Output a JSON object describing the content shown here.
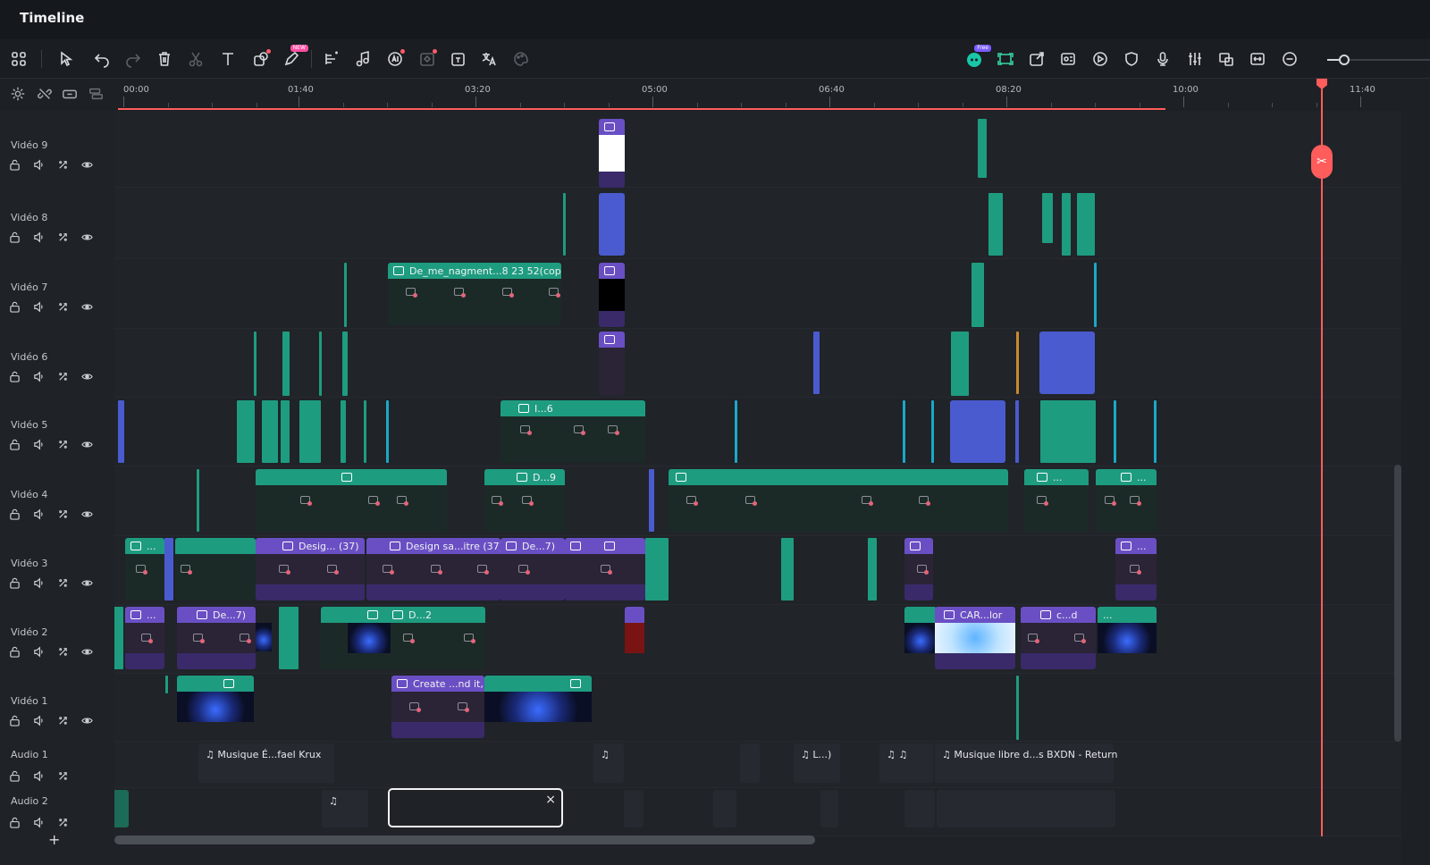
{
  "window": {
    "title": "Timeline"
  },
  "toolbar": {
    "left_tools": [
      "grid-menu",
      "select-pointer",
      "undo",
      "redo",
      "delete",
      "split",
      "text",
      "crop",
      "paint-pen",
      "speed-ramp",
      "audio-beat",
      "ai-tool",
      "keyframe",
      "extract",
      "translate",
      "color-palette"
    ],
    "new_badge": "NEW",
    "free_badge": "Free",
    "right_tools": [
      "ai-mate",
      "auto-reframe",
      "export-clip",
      "multicam",
      "motion-track",
      "shield",
      "microphone",
      "mixer",
      "split-screen",
      "fit-timeline",
      "zoom-out"
    ],
    "zoom_level": 0.15
  },
  "ruler": {
    "labels": [
      "00:00",
      "01:40",
      "03:20",
      "05:00",
      "06:40",
      "08:20",
      "10:00",
      "11:40"
    ]
  },
  "tracks": [
    {
      "name": "Vidéo 9"
    },
    {
      "name": "Vidéo 8"
    },
    {
      "name": "Vidéo 7"
    },
    {
      "name": "Vidéo 6"
    },
    {
      "name": "Vidéo 5"
    },
    {
      "name": "Vidéo 4"
    },
    {
      "name": "Vidéo 3"
    },
    {
      "name": "Vidéo 2"
    },
    {
      "name": "Vidéo 1"
    },
    {
      "name": "Audio 1"
    },
    {
      "name": "Audio 2"
    }
  ],
  "clips": {
    "v7_main": "De_me_nagment...8 23 52(copy)",
    "v5_a": "I...6",
    "v4_a": "D...9",
    "v4_b": "...",
    "v4_c": "...",
    "v3_a": "...",
    "v3_b": "Desig... (37)",
    "v3_c": "Design sa...itre (37)",
    "v3_d": "De...7)",
    "v3_e": "...",
    "v2_a": "...",
    "v2_b": "De...7)",
    "v2_c": "D...2",
    "v2_d": "CAR...lor",
    "v2_e": "c...d",
    "v2_f": "...",
    "v1_a": "Create ...nd it,",
    "a1_a": "Musique É...fael Krux",
    "a1_b": "L...)",
    "a1_c": "Musique libre d...s BXDN - Return"
  },
  "add_track": "+",
  "selection_close": "×",
  "colors": {
    "video_clip": "#1e9c80",
    "image_clip": "#6a4fc4",
    "text_clip": "#4a5bcf",
    "playhead": "#ff5c5c"
  }
}
